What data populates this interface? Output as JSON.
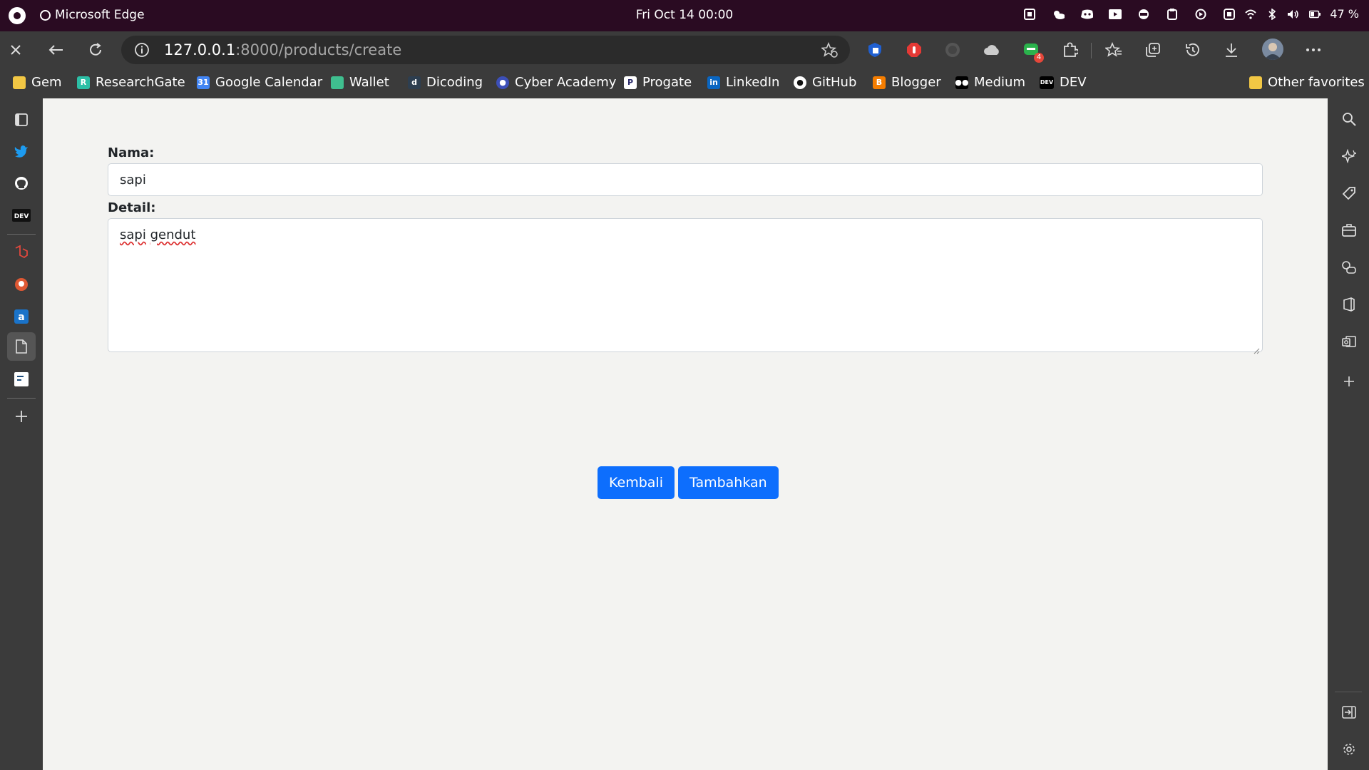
{
  "system": {
    "app_name": "Microsoft Edge",
    "clock": "Fri Oct 14  00:00",
    "battery": "47 %"
  },
  "browser": {
    "url_host": "127.0.0.1",
    "url_path": ":8000/products/create",
    "bookmarks": [
      {
        "label": "Gem",
        "icon": "folder-icon",
        "color": "#f2c744"
      },
      {
        "label": "ResearchGate",
        "icon": "researchgate-icon",
        "color": "#2cbfa6"
      },
      {
        "label": "Google Calendar",
        "icon": "google-calendar-icon",
        "color": "#4285f4"
      },
      {
        "label": "Wallet",
        "icon": "wallet-icon",
        "color": "#3fbf8f"
      },
      {
        "label": "Dicoding",
        "icon": "dicoding-icon",
        "color": "#2d3e50"
      },
      {
        "label": "Cyber Academy",
        "icon": "shield-icon",
        "color": "#3c4fb8"
      },
      {
        "label": "Progate",
        "icon": "progate-icon",
        "color": "#ffffff"
      },
      {
        "label": "LinkedIn",
        "icon": "linkedin-icon",
        "color": "#0a66c2"
      },
      {
        "label": "GitHub",
        "icon": "github-icon",
        "color": "#ffffff"
      },
      {
        "label": "Blogger",
        "icon": "blogger-icon",
        "color": "#f57d00"
      },
      {
        "label": "Medium",
        "icon": "medium-icon",
        "color": "#000000"
      },
      {
        "label": "DEV",
        "icon": "dev-icon",
        "color": "#000000"
      }
    ],
    "other_favorites": "Other favorites"
  },
  "form": {
    "nama_label": "Nama:",
    "nama_value": "sapi",
    "detail_label": "Detail:",
    "detail_value_word1": "sapi",
    "detail_value_word2": "gendut",
    "back_button": "Kembali",
    "submit_button": "Tambahkan"
  },
  "colors": {
    "primary_button": "#0d6efd",
    "topbar": "#2a0b22",
    "chrome": "#3b3b3b"
  }
}
